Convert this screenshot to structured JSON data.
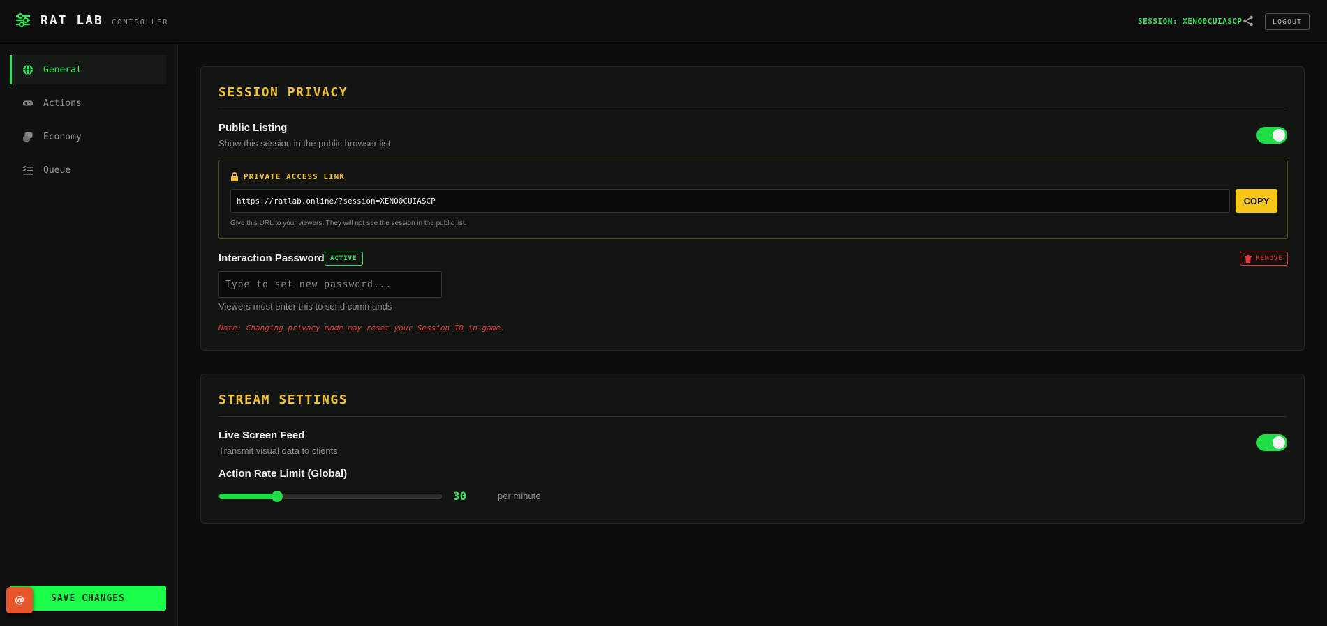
{
  "header": {
    "brand_title": "RAT LAB",
    "brand_subtitle": "CONTROLLER",
    "session_label": "SESSION: XENO0CUIASCP",
    "logout_label": "LOGOUT"
  },
  "sidebar": {
    "items": [
      {
        "label": "General",
        "icon": "globe-icon",
        "active": true
      },
      {
        "label": "Actions",
        "icon": "gamepad-icon",
        "active": false
      },
      {
        "label": "Economy",
        "icon": "coins-icon",
        "active": false
      },
      {
        "label": "Queue",
        "icon": "list-check-icon",
        "active": false
      }
    ],
    "save_label": "SAVE CHANGES",
    "badge_label": "@"
  },
  "privacy": {
    "title": "SESSION PRIVACY",
    "public_listing": {
      "title": "Public Listing",
      "subtitle": "Show this session in the public browser list",
      "enabled": true
    },
    "access_link": {
      "label": "PRIVATE ACCESS LINK",
      "url": "https://ratlab.online/?session=XENO0CUIASCP",
      "copy_label": "COPY",
      "help": "Give this URL to your viewers. They will not see the session in the public list."
    },
    "password": {
      "title": "Interaction Password",
      "badge": "ACTIVE",
      "remove_label": "REMOVE",
      "placeholder": "Type to set new password...",
      "help": "Viewers must enter this to send commands"
    },
    "note": "Note: Changing privacy mode may reset your Session ID in-game."
  },
  "stream": {
    "title": "STREAM SETTINGS",
    "live_feed": {
      "title": "Live Screen Feed",
      "subtitle": "Transmit visual data to clients",
      "enabled": true
    },
    "rate_limit": {
      "title": "Action Rate Limit (Global)",
      "value": "30",
      "fraction": 0.26,
      "unit": "per minute"
    }
  },
  "colors": {
    "accent_green": "#2ee656",
    "accent_yellow": "#f2c233",
    "danger_red": "#e53935"
  }
}
